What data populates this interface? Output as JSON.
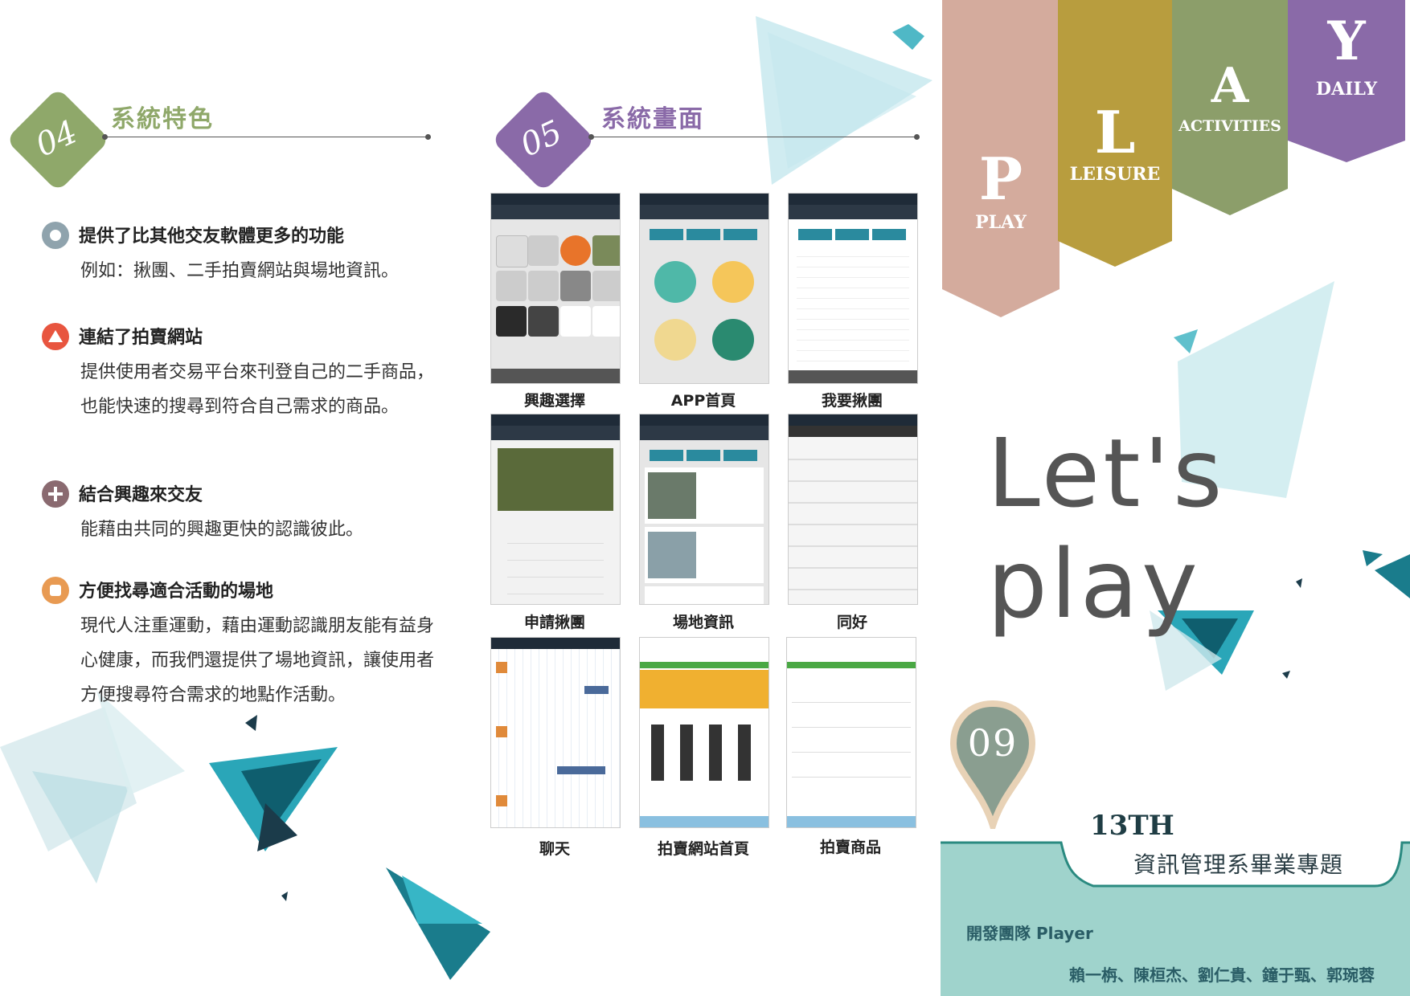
{
  "section4": {
    "num": "04",
    "title": "系統特色"
  },
  "section5": {
    "num": "05",
    "title": "系統畫面"
  },
  "features": [
    {
      "title": "提供了比其他交友軟體更多的功能",
      "body": "例如：揪團、二手拍賣網站與場地資訊。",
      "icon": "circle-icon",
      "color": "#8fa3ad"
    },
    {
      "title": "連結了拍賣網站",
      "body": "提供使用者交易平台來刊登自己的二手商品，也能快速的搜尋到符合自己需求的商品。",
      "icon": "triangle-icon",
      "color": "#e8553f"
    },
    {
      "title": "結合興趣來交友",
      "body": "能藉由共同的興趣更快的認識彼此。",
      "icon": "plus-icon",
      "color": "#8a6a70"
    },
    {
      "title": "方便找尋適合活動的場地",
      "body": "現代人注重運動，藉由運動認識朋友能有益身心健康，而我們還提供了場地資訊，讓使用者方便搜尋符合需求的地點作活動。",
      "icon": "square-icon",
      "color": "#e89a52"
    }
  ],
  "screens": [
    {
      "caption": "興趣選擇"
    },
    {
      "caption": "APP首頁"
    },
    {
      "caption": "我要揪團"
    },
    {
      "caption": "申請揪團"
    },
    {
      "caption": "場地資訊"
    },
    {
      "caption": "同好"
    },
    {
      "caption": "聊天"
    },
    {
      "caption": "拍賣網站首頁"
    },
    {
      "caption": "拍賣商品"
    }
  ],
  "banners": [
    {
      "letter": "P",
      "word": "PLAY",
      "color": "#d4ab9d"
    },
    {
      "letter": "L",
      "word": "LEISURE",
      "color": "#b89d3e"
    },
    {
      "letter": "A",
      "word": "ACTIVITIES",
      "color": "#8c9e6a"
    },
    {
      "letter": "Y",
      "word": "DAILY",
      "color": "#8a6aa8"
    }
  ],
  "title": "Let's play",
  "pin_number": "09",
  "edition": "13TH",
  "department": "資訊管理系畢業專題",
  "team_label": "開發團隊 Player",
  "members": "賴一栴、陳桓杰、劉仁貴、鐘于甄、郭琬蓉"
}
